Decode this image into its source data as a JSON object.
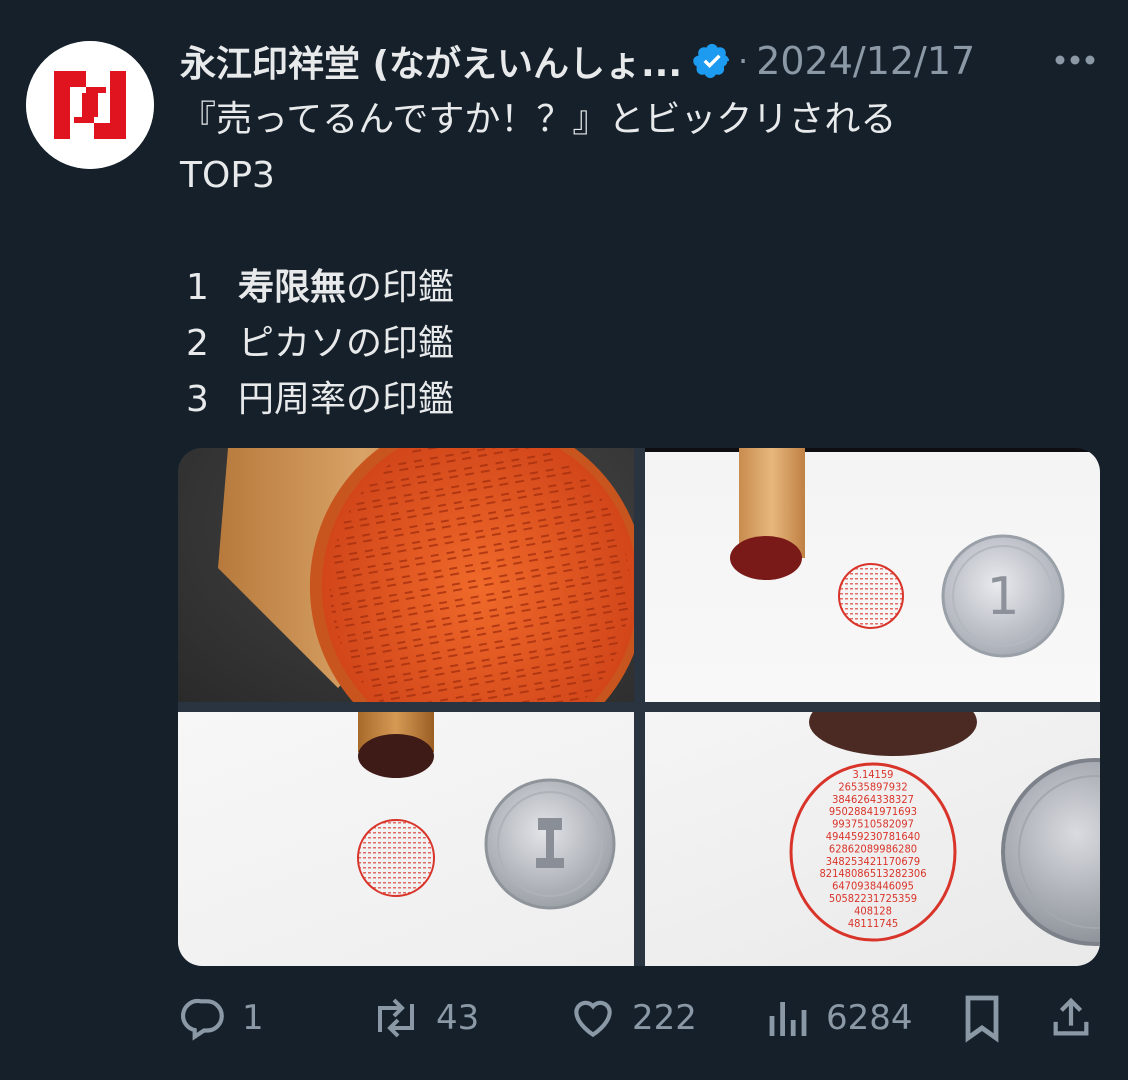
{
  "tweet": {
    "author_name": "永江印祥堂 (ながえいんしょ...",
    "separator": "·",
    "date": "2024/12/17",
    "text_line1": "『売ってるんですか！？』とビックリされる",
    "text_line2": "TOP3",
    "list": [
      {
        "num": "1",
        "bold": "寿限無",
        "rest": "の印鑑"
      },
      {
        "num": "2",
        "bold": "",
        "rest": "ピカソの印鑑"
      },
      {
        "num": "3",
        "bold": "",
        "rest": "円周率の印鑑"
      }
    ]
  },
  "media": {
    "pi_digits": [
      "3.14159",
      "26535897932",
      "3846264338327",
      "95028841971693",
      "9937510582097",
      "494459230781640",
      "62862089986280",
      "348253421170679",
      "82148086513282306",
      "6470938446095",
      "50582231725359",
      "408128",
      "48111745"
    ]
  },
  "actions": {
    "replies": "1",
    "reposts": "43",
    "likes": "222",
    "views": "6284"
  },
  "colors": {
    "background": "#15202b",
    "text": "#e7e9ea",
    "secondary": "#8b98a5",
    "verified": "#1d9bf0",
    "logo_red": "#e0141e",
    "stamp_red": "#d9342a"
  },
  "icons": [
    "avatar-logo",
    "verified-badge-icon",
    "more-icon",
    "reply-icon",
    "repost-icon",
    "like-icon",
    "views-icon",
    "bookmark-icon",
    "share-icon"
  ]
}
